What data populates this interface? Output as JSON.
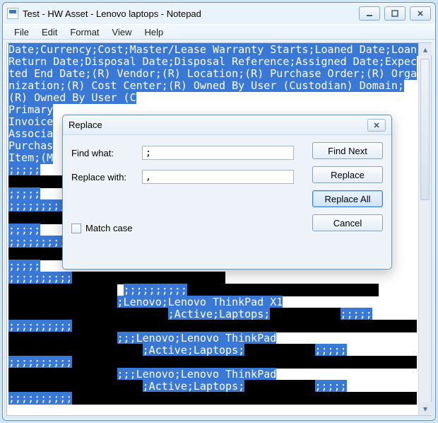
{
  "window": {
    "title": "Test - HW Asset - Lenovo laptops - Notepad"
  },
  "menubar": {
    "items": [
      "File",
      "Edit",
      "Format",
      "View",
      "Help"
    ]
  },
  "dialog": {
    "title": "Replace",
    "find_label": "Find what:",
    "find_value": ";",
    "replace_label": "Replace with:",
    "replace_value": ",",
    "match_case_label": "Match case",
    "buttons": {
      "find_next": "Find Next",
      "replace": "Replace",
      "replace_all": "Replace All",
      "cancel": "Cancel"
    }
  },
  "editor": {
    "selected_header": "Date;Currency;Cost;Master/Lease Warranty Starts;Loaned Date;Loan Return Date;Disposal Date;Disposal Reference;Assigned Date;Expected End Date;(R) Vendor;(R) Location;(R) Purchase Order;(R) Organization;(R) Cost Center;(R) Owned By User (Custodian) Domain;(R) Owned By User (C",
    "left_col_fragments": {
      "r1": "Primary",
      "r2": "Invoice",
      "r3": "Associa",
      "r4": "Purchas",
      "r5": "Item;(M"
    },
    "right_tail": ";;;;;",
    "semicolons_long": ";;;;;;;;;;",
    "product_lines": {
      "p1a": ";Lenovo;Lenovo ThinkPad X1",
      "p1b": ";Active;Laptops;",
      "p2a": ";;;Lenovo;Lenovo ThinkPad",
      "p2b": ";Active;Laptops;",
      "p3a": ";;;Lenovo;Lenovo ThinkPad",
      "p3b": ";Active;Laptops;"
    }
  }
}
